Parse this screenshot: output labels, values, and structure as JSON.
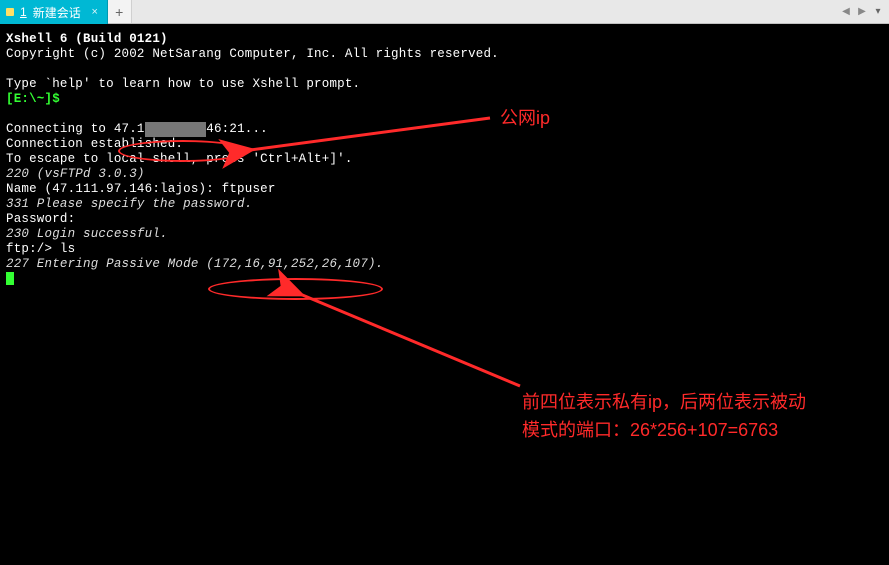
{
  "tab": {
    "index": "1",
    "title": "新建会话"
  },
  "terminal": {
    "l1_bold": "Xshell 6 (Build 0121)",
    "l2": "Copyright (c) 2002 NetSarang Computer, Inc. All rights reserved.",
    "l3": "",
    "l4": "Type `help' to learn how to use Xshell prompt.",
    "prompt": "[E:\\~]$ ",
    "l5": "",
    "l6a": "Connecting to ",
    "l6_ip_visible_prefix": "47.1",
    "l6_censored": "        ",
    "l6b": "46:21...",
    "l7": "Connection established.",
    "l8": "To escape to local shell, press 'Ctrl+Alt+]'.",
    "l9_it": "220 (vsFTPd 3.0.3)",
    "l10a": "Name (",
    "l10b": "47.111.97.146",
    "l10c": ":lajos): ftpuser",
    "l11_it": "331 Please specify the password.",
    "l12": "Password:",
    "l13_it": "230 Login successful.",
    "l14": "ftp:/> ls",
    "l15_it_a": "227 Entering Passive Mode ",
    "l15_it_b": "(172,16,91,252,26,107)",
    "l15_it_c": "."
  },
  "annotations": {
    "a1": "公网ip",
    "a2_line1": "前四位表示私有ip，后两位表示被动",
    "a2_line2": "模式的端口：26*256+107=6763"
  },
  "passive_mode": {
    "ip_octets": [
      172,
      16,
      91,
      252
    ],
    "port_hi": 26,
    "port_lo": 107,
    "port": 6763
  }
}
